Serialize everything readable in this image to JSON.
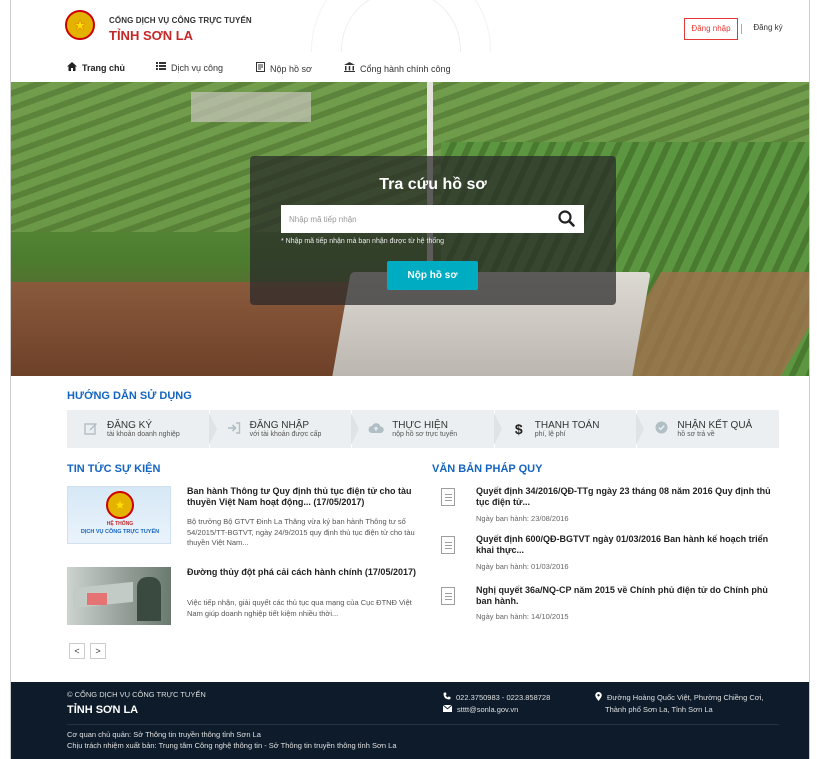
{
  "header": {
    "brand_top": "CỔNG DỊCH VỤ CÔNG TRỰC TUYẾN",
    "brand_main": "TỈNH SƠN LA",
    "login_label": "Đăng nhập",
    "register_label": "Đăng ký"
  },
  "nav": {
    "items": [
      {
        "label": "Trang chủ",
        "icon": "home-icon"
      },
      {
        "label": "Dịch vụ công",
        "icon": "list-icon"
      },
      {
        "label": "Nộp hồ sơ",
        "icon": "document-icon"
      },
      {
        "label": "Cổng hành chính công",
        "icon": "building-icon"
      }
    ]
  },
  "search": {
    "title": "Tra cứu hồ sơ",
    "placeholder": "Nhập mã tiếp nhận",
    "hint": "* Nhập mã tiếp nhận mà bạn nhận được từ hệ thống",
    "submit_label": "Nộp hồ sơ"
  },
  "guide": {
    "title": "HƯỚNG DẪN SỬ DỤNG",
    "steps": [
      {
        "title": "ĐĂNG KÝ",
        "subtitle": "tài khoản doanh nghiệp",
        "icon": "edit-icon"
      },
      {
        "title": "ĐĂNG NHẬP",
        "subtitle": "với tài khoản được cấp",
        "icon": "sign-in-icon"
      },
      {
        "title": "THỰC HIỆN",
        "subtitle": "nộp hồ sơ trực tuyến",
        "icon": "cloud-upload-icon"
      },
      {
        "title": "THANH TOÁN",
        "subtitle": "phí, lệ phí",
        "icon": "dollar-icon"
      },
      {
        "title": "NHẬN KẾT QUẢ",
        "subtitle": "hồ sơ trả về",
        "icon": "check-circle-icon"
      }
    ]
  },
  "news": {
    "title": "TIN TỨC SỰ KIỆN",
    "thumb1_text_1": "HỆ THỐNG",
    "thumb1_text_2": "DỊCH VỤ CÔNG TRỰC TUYẾN",
    "items": [
      {
        "title": "Ban hành Thông tư Quy định thủ tục điện tử cho tàu thuyền Việt Nam hoạt động... (17/05/2017)",
        "desc": "Bộ trưởng Bộ GTVT Đinh La Thăng vừa ký ban hành Thông tư số 54/2015/TT-BGTVT, ngày 24/9/2015 quy định thủ tục điện tử cho tàu thuyền Việt Nam..."
      },
      {
        "title": "Đường thủy đột phá cải cách hành chính (17/05/2017)",
        "desc": "Việc tiếp nhận, giải quyết các thủ tục qua mạng của Cục ĐTNĐ Việt Nam giúp doanh nghiệp tiết kiệm nhiều thời..."
      }
    ],
    "prev_label": "<",
    "next_label": ">"
  },
  "documents": {
    "title": "VĂN BẢN PHÁP QUY",
    "items": [
      {
        "title": "Quyết định 34/2016/QĐ-TTg ngày 23 tháng 08 năm 2016 Quy định thủ tục điện tử...",
        "date": "Ngày ban hành: 23/08/2016"
      },
      {
        "title": "Quyết định 600/QĐ-BGTVT ngày 01/03/2016 Ban hành kế hoạch triển khai thực...",
        "date": "Ngày ban hành: 01/03/2016"
      },
      {
        "title": "Nghị quyết 36a/NQ-CP năm 2015 về Chính phủ điện tử do Chính phủ ban hành.",
        "date": "Ngày ban hành: 14/10/2015"
      }
    ]
  },
  "footer": {
    "top": "© CỔNG DỊCH VỤ CÔNG TRỰC TUYẾN",
    "main": "TỈNH SƠN LA",
    "phone": "022.3750983 - 0223.858728",
    "email": "stttt@sonla.gov.vn",
    "address_1": "Đường Hoàng Quốc Việt, Phường Chiềng Cơi,",
    "address_2": "Thành phố Sơn La, Tỉnh Sơn La",
    "owner": "Cơ quan chủ quản: Sở Thông tin truyền thông tỉnh Sơn La",
    "responsible": "Chịu trách nhiệm xuất bản: Trung tâm Công nghệ thông tin - Sở Thông tin truyền thông tỉnh Sơn La"
  },
  "colors": {
    "brand_red": "#c62828",
    "accent_blue": "#1565c0",
    "button_teal": "#00acc1",
    "footer_bg": "#0d1b2a"
  }
}
